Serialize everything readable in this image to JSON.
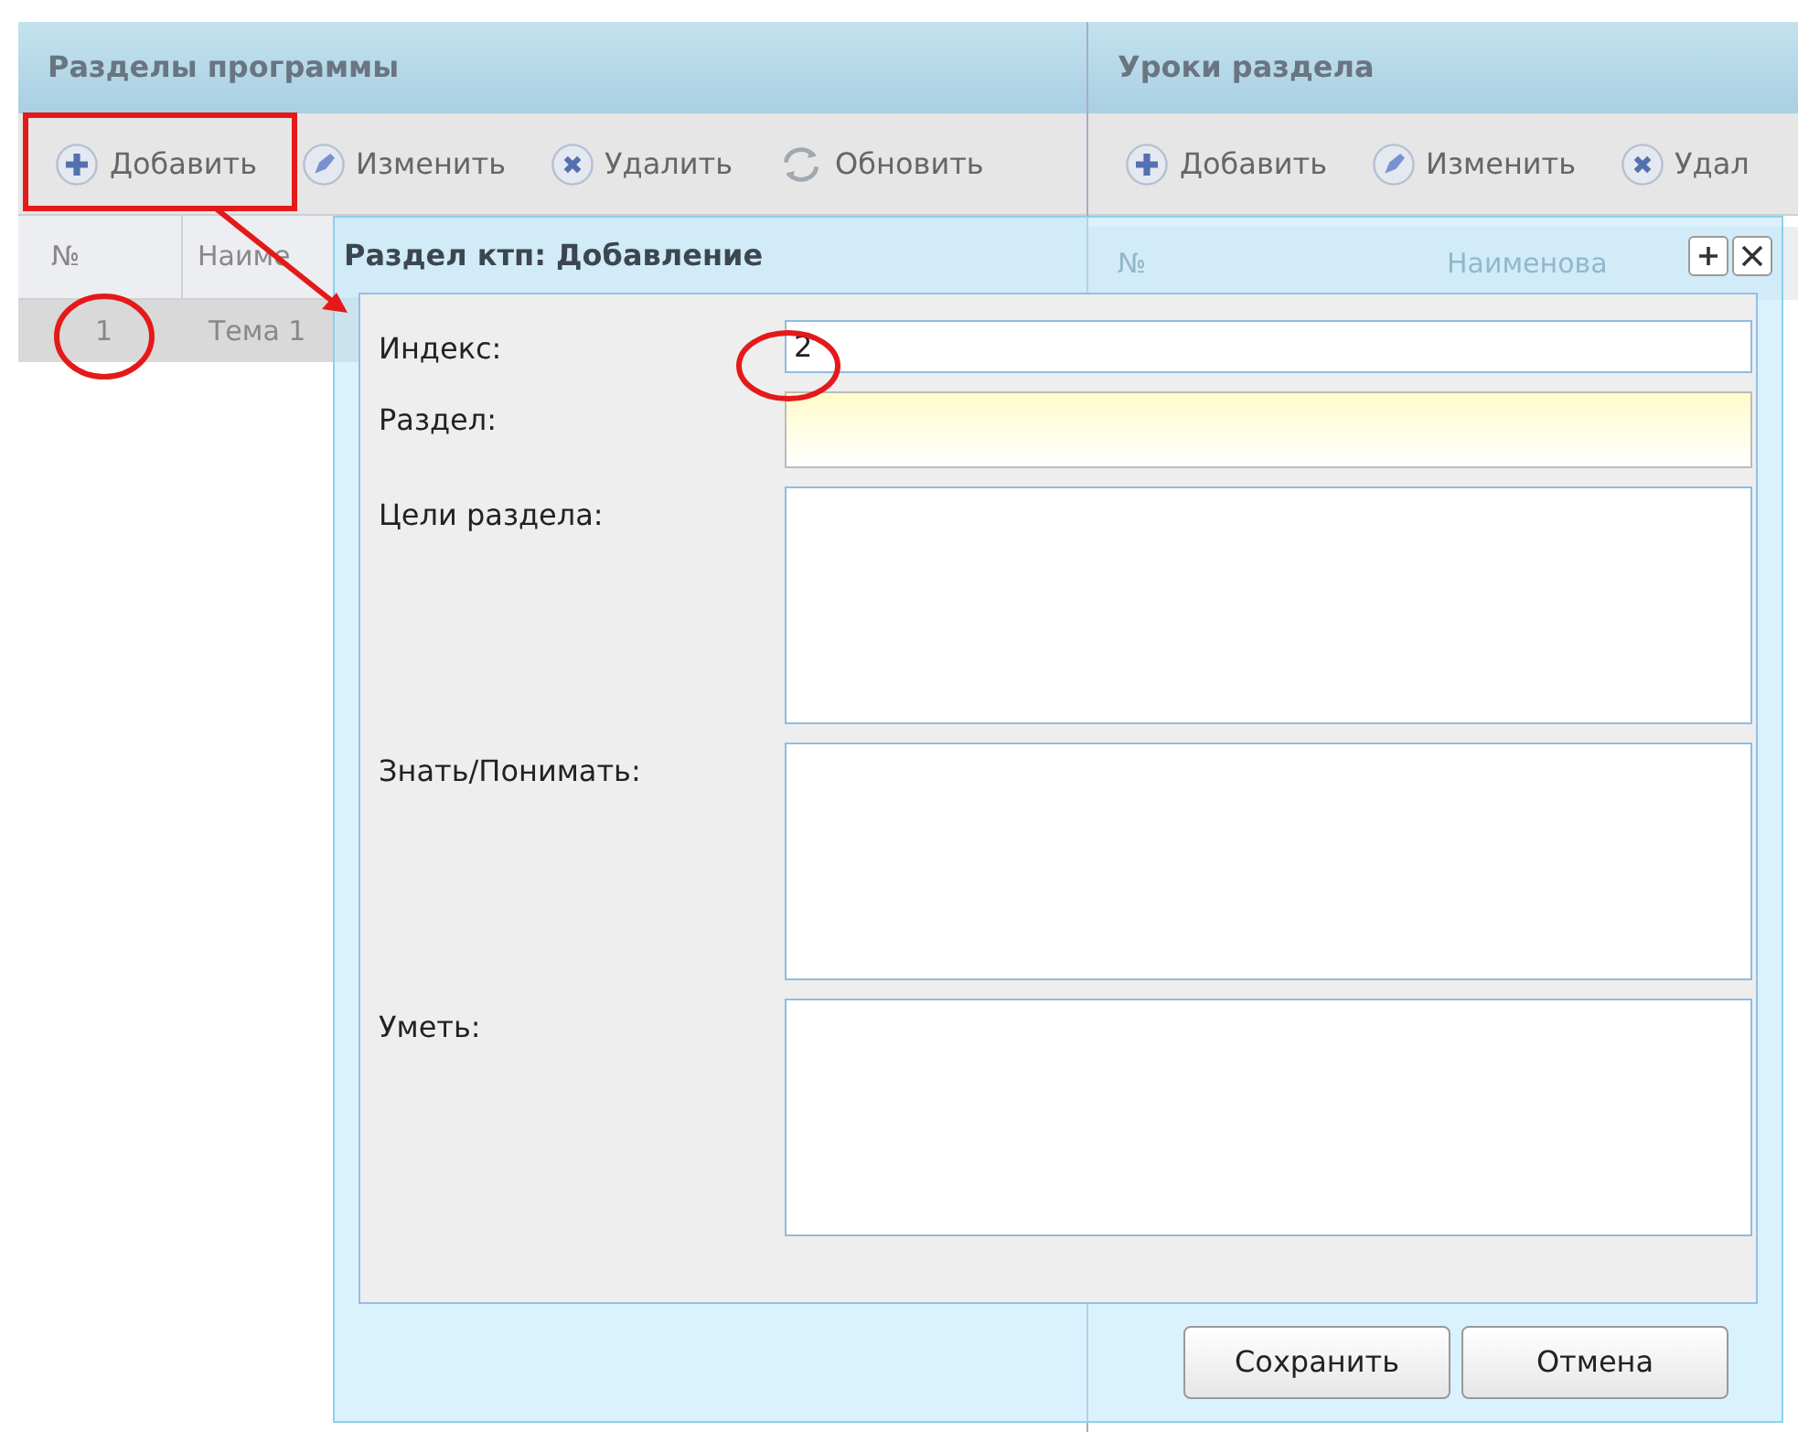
{
  "left_panel": {
    "title": "Разделы программы",
    "toolbar": [
      {
        "kind": "add",
        "label": "Добавить"
      },
      {
        "kind": "edit",
        "label": "Изменить"
      },
      {
        "kind": "delete",
        "label": "Удалить"
      },
      {
        "kind": "refresh",
        "label": "Обновить"
      }
    ],
    "columns": [
      "№",
      "Наиме"
    ],
    "rows": [
      {
        "number": "1",
        "name": "Тема 1",
        "selected": true
      }
    ]
  },
  "right_panel": {
    "title": "Уроки раздела",
    "toolbar": [
      {
        "kind": "add",
        "label": "Добавить"
      },
      {
        "kind": "edit",
        "label": "Изменить"
      },
      {
        "kind": "delete",
        "label": "Удал"
      }
    ],
    "columns": [
      "№",
      "Наименова"
    ]
  },
  "dialog": {
    "title": "Раздел ктп: Добавление",
    "fields": [
      {
        "label": "Индекс:",
        "kind": "input",
        "value": "2",
        "required": false
      },
      {
        "label": "Раздел:",
        "kind": "input",
        "required": true
      },
      {
        "label": "Цели раздела:",
        "kind": "textarea",
        "required": false
      },
      {
        "label": "Знать/Понимать:",
        "kind": "textarea",
        "required": false
      },
      {
        "label": "Уметь:",
        "kind": "textarea",
        "required": false
      }
    ],
    "buttons": [
      "Сохранить",
      "Отмена"
    ]
  }
}
